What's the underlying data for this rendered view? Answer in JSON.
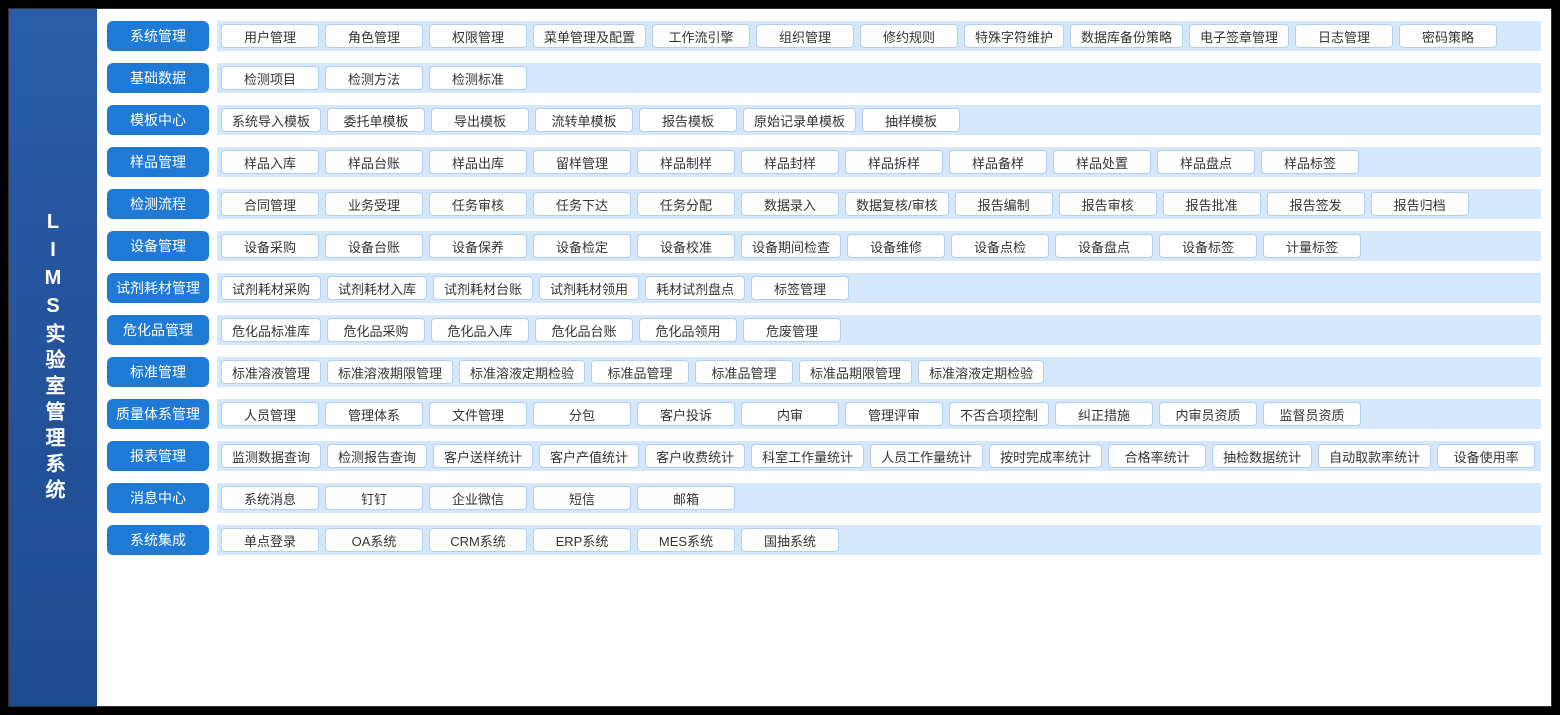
{
  "sidebar": {
    "line1": "LIMS",
    "line2": "实验室管理系统"
  },
  "rows": [
    {
      "category": "系统管理",
      "items": [
        "用户管理",
        "角色管理",
        "权限管理",
        "菜单管理及配置",
        "工作流引擎",
        "组织管理",
        "修约规则",
        "特殊字符维护",
        "数据库备份策略",
        "电子签章管理",
        "日志管理",
        "密码策略"
      ]
    },
    {
      "category": "基础数据",
      "items": [
        "检测项目",
        "检测方法",
        "检测标准"
      ]
    },
    {
      "category": "模板中心",
      "items": [
        "系统导入模板",
        "委托单模板",
        "导出模板",
        "流转单模板",
        "报告模板",
        "原始记录单模板",
        "抽样模板"
      ]
    },
    {
      "category": "样品管理",
      "items": [
        "样品入库",
        "样品台账",
        "样品出库",
        "留样管理",
        "样品制样",
        "样品封样",
        "样品拆样",
        "样品备样",
        "样品处置",
        "样品盘点",
        "样品标签"
      ]
    },
    {
      "category": "检测流程",
      "items": [
        "合同管理",
        "业务受理",
        "任务审核",
        "任务下达",
        "任务分配",
        "数据录入",
        "数据复核/审核",
        "报告编制",
        "报告审核",
        "报告批准",
        "报告签发",
        "报告归档"
      ]
    },
    {
      "category": "设备管理",
      "items": [
        "设备采购",
        "设备台账",
        "设备保养",
        "设备检定",
        "设备校准",
        "设备期间检查",
        "设备维修",
        "设备点检",
        "设备盘点",
        "设备标签",
        "计量标签"
      ]
    },
    {
      "category": "试剂耗材管理",
      "items": [
        "试剂耗材采购",
        "试剂耗材入库",
        "试剂耗材台账",
        "试剂耗材领用",
        "耗材试剂盘点",
        "标签管理"
      ]
    },
    {
      "category": "危化品管理",
      "items": [
        "危化品标准库",
        "危化品采购",
        "危化品入库",
        "危化品台账",
        "危化品领用",
        "危废管理"
      ]
    },
    {
      "category": "标准管理",
      "items": [
        "标准溶液管理",
        "标准溶液期限管理",
        "标准溶液定期检验",
        "标准品管理",
        "标准品管理",
        "标准品期限管理",
        "标准溶液定期检验"
      ]
    },
    {
      "category": "质量体系管理",
      "items": [
        "人员管理",
        "管理体系",
        "文件管理",
        "分包",
        "客户投诉",
        "内审",
        "管理评审",
        "不否合项控制",
        "纠正措施",
        "内审员资质",
        "监督员资质"
      ]
    },
    {
      "category": "报表管理",
      "items": [
        "监测数据查询",
        "检测报告查询",
        "客户送样统计",
        "客户产值统计",
        "客户收费统计",
        "科室工作量统计",
        "人员工作量统计",
        "按时完成率统计",
        "合格率统计",
        "抽检数据统计",
        "自动取款率统计",
        "设备使用率"
      ]
    },
    {
      "category": "消息中心",
      "items": [
        "系统消息",
        "钉钉",
        "企业微信",
        "短信",
        "邮箱"
      ]
    },
    {
      "category": "系统集成",
      "items": [
        "单点登录",
        "OA系统",
        "CRM系统",
        "ERP系统",
        "MES系统",
        "国抽系统"
      ]
    }
  ]
}
